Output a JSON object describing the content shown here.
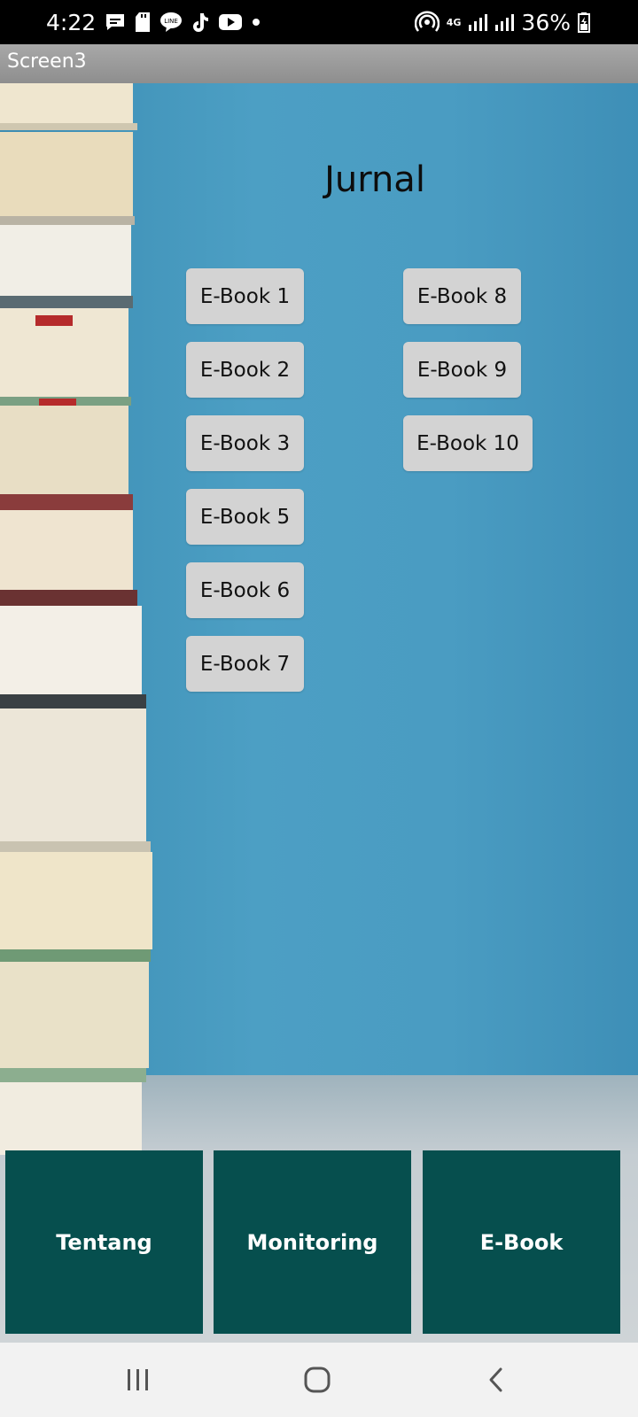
{
  "status_bar": {
    "time": "4:22",
    "battery": "36%",
    "network": "4G",
    "left_icons": [
      "message-icon",
      "sd-card-icon",
      "line-app-icon",
      "tiktok-icon",
      "youtube-icon",
      "dot-icon"
    ],
    "right_icons": [
      "hotspot-icon",
      "network-4g-icon",
      "signal-icon",
      "signal-icon",
      "battery-icon"
    ]
  },
  "app_bar": {
    "title": "Screen3"
  },
  "page": {
    "heading": "Jurnal"
  },
  "ebook_buttons": [
    {
      "label": "E-Book 1"
    },
    {
      "label": "E-Book 2"
    },
    {
      "label": "E-Book 3"
    },
    {
      "label": "E-Book 5"
    },
    {
      "label": "E-Book 6"
    },
    {
      "label": "E-Book 7"
    },
    {
      "label": "E-Book 8"
    },
    {
      "label": "E-Book 9"
    },
    {
      "label": "E-Book 10"
    }
  ],
  "bottom_nav": [
    {
      "label": "Tentang"
    },
    {
      "label": "Monitoring"
    },
    {
      "label": "E-Book"
    }
  ],
  "system_nav": [
    "recent-apps-icon",
    "home-icon",
    "back-icon"
  ],
  "colors": {
    "tile": "#064f4e",
    "button": "#d3d3d3",
    "background": "#4a9cc2"
  }
}
